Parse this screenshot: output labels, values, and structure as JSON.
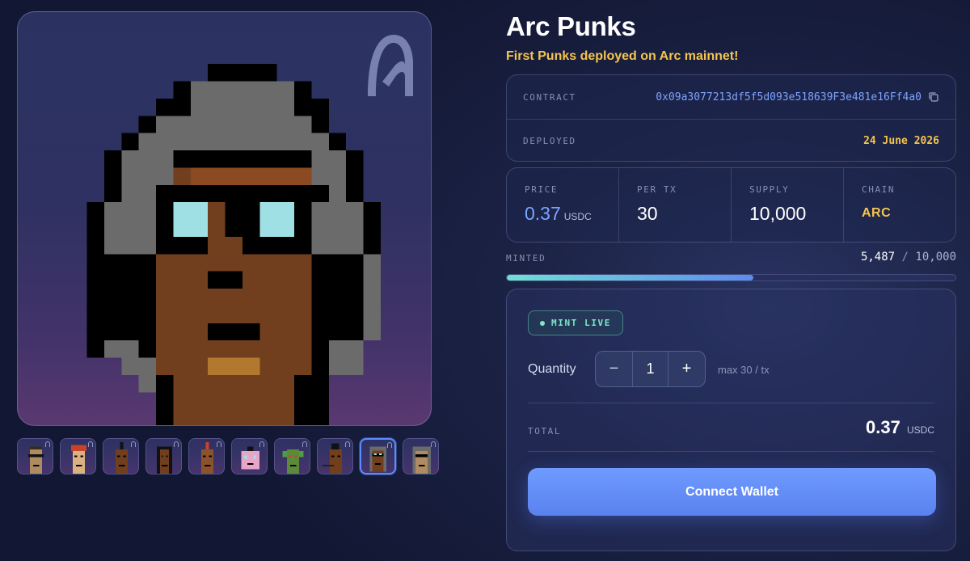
{
  "collection": {
    "title": "Arc Punks",
    "subtitle": "First Punks deployed on Arc mainnet!"
  },
  "contract": {
    "label": "CONTRACT",
    "address": "0x09a3077213df5f5d093e518639F3e481e16Ff4a0",
    "deployed_label": "DEPLOYED",
    "deployed_value": "24 June 2026"
  },
  "stats": {
    "price_label": "PRICE",
    "price_value": "0.37",
    "price_unit": "USDC",
    "per_tx_label": "PER TX",
    "per_tx_value": "30",
    "supply_label": "SUPPLY",
    "supply_value": "10,000",
    "chain_label": "CHAIN",
    "chain_value": "ARC"
  },
  "minted": {
    "label": "MINTED",
    "count": "5,487",
    "separator": "/",
    "total": "10,000",
    "fraction": 0.5487
  },
  "mint": {
    "status": "MINT LIVE",
    "quantity_label": "Quantity",
    "decrement": "−",
    "quantity_value": "1",
    "increment": "+",
    "max_note": "max 30 / tx",
    "total_label": "TOTAL",
    "total_value": "0.37",
    "total_unit": "USDC",
    "connect_label": "Connect Wallet"
  },
  "thumbnails": {
    "count": 10,
    "selected_index": 8
  },
  "colors": {
    "accent_blue": "#7ea4ff",
    "gold": "#f5c54f",
    "mint_green": "#7ee8c8",
    "button": "#6f9bff"
  }
}
